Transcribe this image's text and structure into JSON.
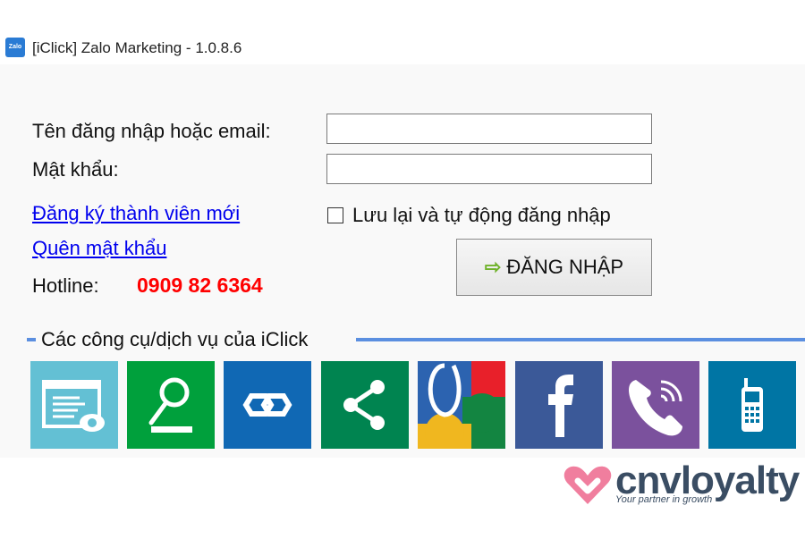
{
  "window": {
    "title": "[iClick] Zalo Marketing - 1.0.8.6",
    "icon_text": "Zalo"
  },
  "form": {
    "username_label": "Tên đăng nhập hoặc email:",
    "username_value": "",
    "password_label": "Mật khẩu:",
    "password_value": "",
    "register_link": "Đăng ký thành viên mới",
    "forgot_link": "Quên mật khẩu",
    "remember_label": "Lưu lại và tự động đăng nhập",
    "remember_checked": false,
    "login_button": "ĐĂNG NHẬP",
    "hotline_label": "Hotline:",
    "hotline_number": "0909 82 6364"
  },
  "tools": {
    "title": "Các công cụ/dịch vụ của iClick",
    "tiles": [
      {
        "icon": "web-monitor-icon",
        "color": "#63c0d4"
      },
      {
        "icon": "search-icon",
        "color": "#00a03c"
      },
      {
        "icon": "link-icon",
        "color": "#1068b4"
      },
      {
        "icon": "share-icon",
        "color": "#008450"
      },
      {
        "icon": "google-icon",
        "color": "#2c63b0"
      },
      {
        "icon": "facebook-icon",
        "color": "#3b5998"
      },
      {
        "icon": "viber-icon",
        "color": "#7b519d"
      },
      {
        "icon": "mobile-phone-icon",
        "color": "#0075a4"
      }
    ]
  },
  "watermark": {
    "brand": "cnvloyalty",
    "tagline": "Your partner in growth"
  }
}
